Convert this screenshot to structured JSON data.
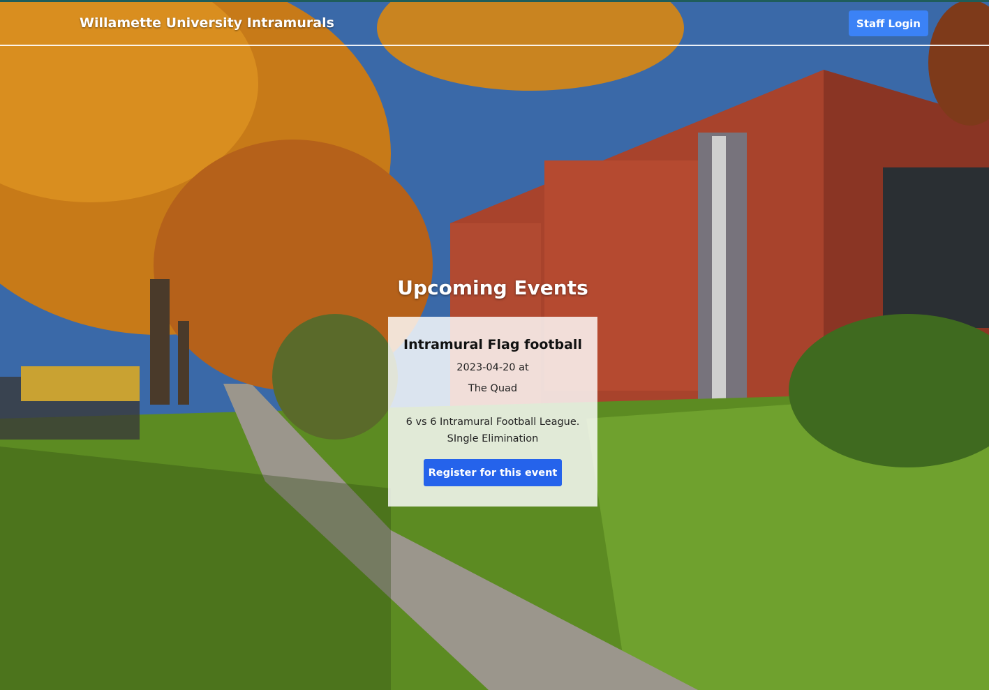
{
  "navbar": {
    "brand": "Willamette University Intramurals",
    "staff_login_label": "Staff Login"
  },
  "events_section": {
    "title": "Upcoming Events",
    "events": [
      {
        "title": "Intramural Flag football",
        "date_line": "2023-04-20 at",
        "location": "The Quad",
        "description": "6 vs 6 Intramural Football League. SIngle Elimination",
        "register_label": "Register for this event"
      }
    ]
  },
  "colors": {
    "top_strip": "#1f5d5a",
    "primary_button": "#3b82f6",
    "register_button": "#2563eb"
  }
}
